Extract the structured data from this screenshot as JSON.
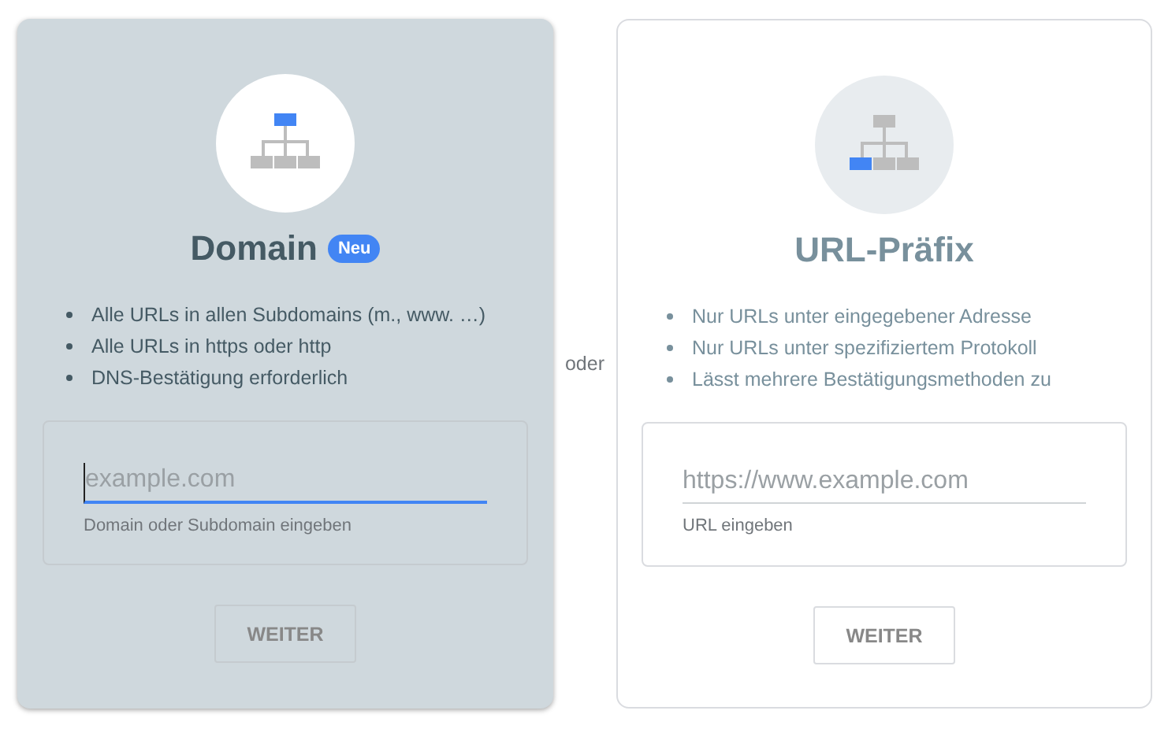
{
  "options": [
    {
      "selected": true,
      "kind": "domain",
      "title": "Domain",
      "badge": "Neu",
      "bullets": [
        "Alle URLs in allen Subdomains (m., www. …)",
        "Alle URLs in https oder http",
        "DNS-Bestätigung erforderlich"
      ],
      "field": {
        "placeholder": "example.com",
        "focused": true,
        "helper": "Domain oder Subdomain eingeben"
      },
      "button": {
        "label": "WEITER",
        "disabled": true
      }
    },
    {
      "selected": false,
      "kind": "prefix",
      "title": "URL-Präfix",
      "bullets": [
        "Nur URLs unter eingegebener Adresse",
        "Nur URLs unter spezifiziertem Protokoll",
        "Lässt mehrere Bestätigungsmethoden zu"
      ],
      "field": {
        "placeholder": "https://www.example.com",
        "focused": false,
        "helper": "URL eingeben"
      },
      "button": {
        "label": "WEITER",
        "disabled": true
      }
    }
  ],
  "separator": "oder"
}
